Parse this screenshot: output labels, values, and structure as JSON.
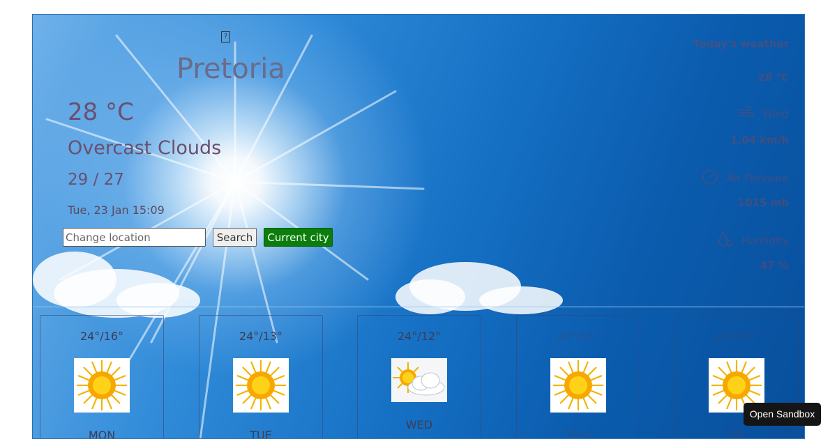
{
  "hero": {
    "icon_glyph": "?",
    "city": "Pretoria",
    "temperature": "28 °C",
    "description": "Overcast Clouds",
    "min_max": "29 / 27",
    "datetime": "Tue, 23 Jan 15:09"
  },
  "search": {
    "placeholder": "Change location",
    "search_label": "Search",
    "current_city_label": "Current city"
  },
  "side": {
    "title": "Today's weather",
    "temperature": "28 °C",
    "wind_label": "Wind",
    "wind_value": "1.04 km/h",
    "pressure_label": "Air Pressure",
    "pressure_value": "1015 mb",
    "humidity_label": "Humidity",
    "humidity_value": "47 %"
  },
  "forecast": [
    {
      "range": "24°/16°",
      "day": "MON",
      "icon": "sun-icon"
    },
    {
      "range": "24°/13°",
      "day": "TUE",
      "icon": "sun-icon"
    },
    {
      "range": "24°/12°",
      "day": "WED",
      "icon": "partly-cloudy-icon"
    },
    {
      "range": "26°/11°",
      "day": "THU",
      "icon": "sun-icon"
    },
    {
      "range": "24°/13°",
      "day": "FRI",
      "icon": "sun-icon"
    }
  ],
  "sandbox_label": "Open Sandbox",
  "colors": {
    "accent_green": "#0b7d0b",
    "sky_blue": "#1570c4",
    "side_text": "#a7403f"
  }
}
